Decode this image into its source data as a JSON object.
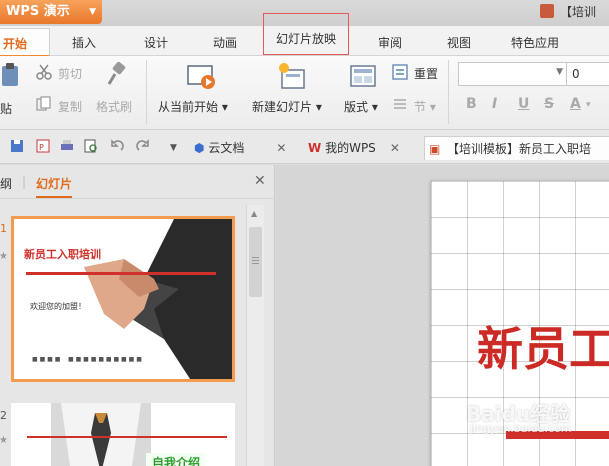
{
  "app": {
    "title": "WPS 演示",
    "doc_title": "【培训"
  },
  "menu": {
    "tabs": [
      {
        "label": "开始"
      },
      {
        "label": "插入"
      },
      {
        "label": "设计"
      },
      {
        "label": "动画"
      },
      {
        "label": "幻灯片放映"
      },
      {
        "label": "审阅"
      },
      {
        "label": "视图"
      },
      {
        "label": "特色应用"
      }
    ]
  },
  "ribbon": {
    "cut": "剪切",
    "paste": "贴",
    "copy": "复制",
    "format_painter": "格式刷",
    "from_current": "从当前开始",
    "new_slide": "新建幻灯片",
    "layout": "版式",
    "reset": "重置",
    "section": "节",
    "font_size": "0",
    "bold": "B",
    "italic": "I",
    "underline": "U",
    "strike": "S",
    "font_color": "A"
  },
  "quickbar": {
    "cloud_doc": "云文档",
    "my_wps": "我的WPS",
    "doc_tab": "【培训模板】新员工入职培"
  },
  "left_panel": {
    "outline_tab": "纲",
    "slides_tab": "幻灯片",
    "slide1_num": "1",
    "slide2_num": "2",
    "slide1_title": "新员工入职培训",
    "slide1_welcome": "欢迎您的加盟！",
    "slide2_label": "自我介绍"
  },
  "canvas": {
    "big_title": "新员工"
  },
  "watermark": {
    "brand": "Baidu经验",
    "url": "jingyan.baidu.com"
  },
  "colors": {
    "accent": "#e06b1a",
    "title_red": "#cc2a24",
    "highlight_border": "#e25a5a"
  }
}
